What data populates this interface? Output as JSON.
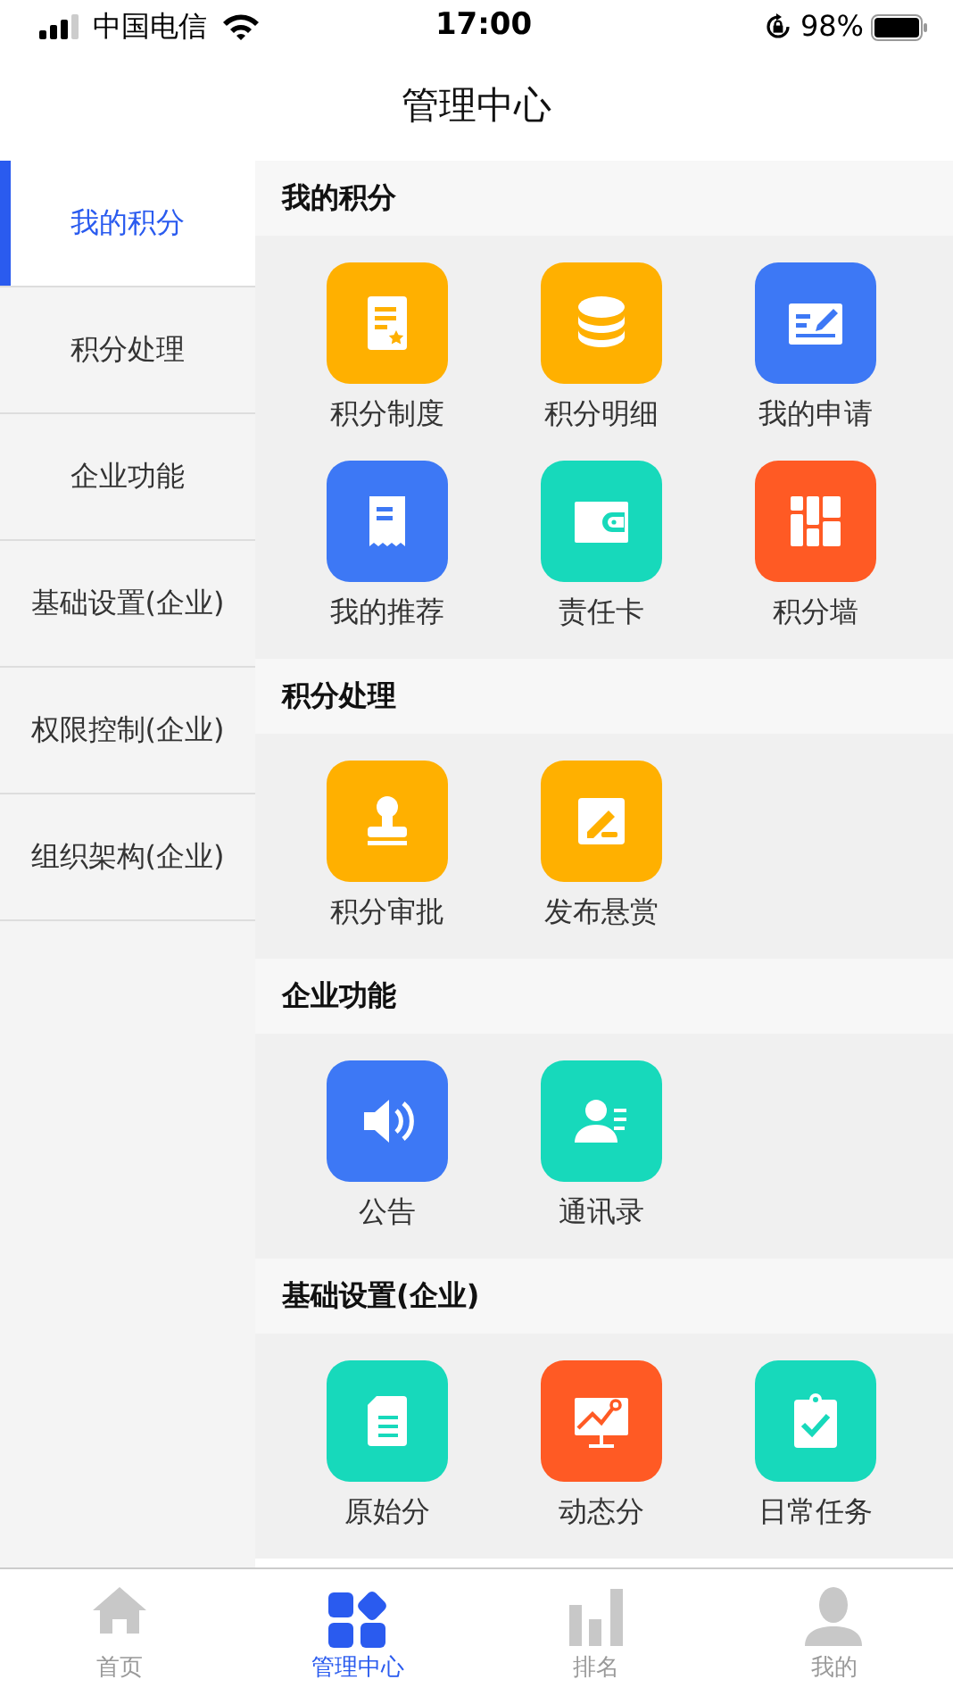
{
  "status_bar": {
    "carrier": "中国电信",
    "time": "17:00",
    "battery": "98%"
  },
  "title": "管理中心",
  "sidebar": {
    "items": [
      {
        "label": "我的积分",
        "selected": true
      },
      {
        "label": "积分处理",
        "selected": false
      },
      {
        "label": "企业功能",
        "selected": false
      },
      {
        "label": "基础设置(企业)",
        "selected": false
      },
      {
        "label": "权限控制(企业)",
        "selected": false
      },
      {
        "label": "组织架构(企业)",
        "selected": false
      }
    ]
  },
  "sections": [
    {
      "title": "我的积分",
      "items": [
        {
          "label": "积分制度",
          "color": "#ffb000"
        },
        {
          "label": "积分明细",
          "color": "#ffb000"
        },
        {
          "label": "我的申请",
          "color": "#3d78f5"
        },
        {
          "label": "我的推荐",
          "color": "#3d78f5"
        },
        {
          "label": "责任卡",
          "color": "#17d9bb"
        },
        {
          "label": "积分墙",
          "color": "#ff5a24"
        }
      ]
    },
    {
      "title": "积分处理",
      "items": [
        {
          "label": "积分审批",
          "color": "#ffb000"
        },
        {
          "label": "发布悬赏",
          "color": "#ffb000"
        }
      ]
    },
    {
      "title": "企业功能",
      "items": [
        {
          "label": "公告",
          "color": "#3d78f5"
        },
        {
          "label": "通讯录",
          "color": "#17d9bb"
        }
      ]
    },
    {
      "title": "基础设置(企业)",
      "items": [
        {
          "label": "原始分",
          "color": "#17d9bb"
        },
        {
          "label": "动态分",
          "color": "#ff5a24"
        },
        {
          "label": "日常任务",
          "color": "#17d9bb"
        }
      ]
    }
  ],
  "tab_bar": [
    {
      "label": "首页",
      "selected": false
    },
    {
      "label": "管理中心",
      "selected": true
    },
    {
      "label": "排名",
      "selected": false
    },
    {
      "label": "我的",
      "selected": false
    }
  ]
}
